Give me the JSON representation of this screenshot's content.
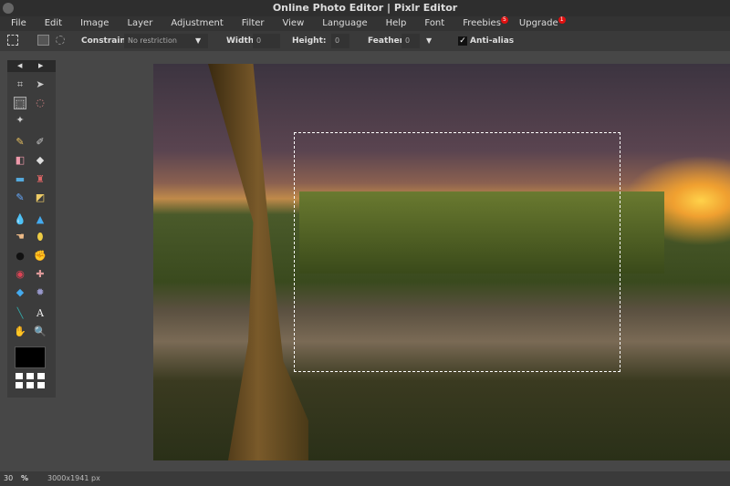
{
  "window": {
    "title": "Online Photo Editor | Pixlr Editor"
  },
  "menu": [
    {
      "label": "File"
    },
    {
      "label": "Edit"
    },
    {
      "label": "Image"
    },
    {
      "label": "Layer"
    },
    {
      "label": "Adjustment"
    },
    {
      "label": "Filter"
    },
    {
      "label": "View"
    },
    {
      "label": "Language"
    },
    {
      "label": "Help"
    },
    {
      "label": "Font"
    },
    {
      "label": "Freebies",
      "badge": "5"
    },
    {
      "label": "Upgrade",
      "badge": "1"
    }
  ],
  "options": {
    "constraint_label": "Constraint:",
    "constraint_value": "No restriction",
    "width_label": "Width:",
    "width_value": "0",
    "height_label": "Height:",
    "height_value": "0",
    "feather_label": "Feather:",
    "feather_value": "0",
    "antialias_label": "Anti-alias",
    "antialias_checked": true
  },
  "tools": [
    "crop-icon",
    "move-icon",
    "marquee-icon",
    "lasso-icon",
    "wand-icon",
    "pencil-icon",
    "brush-icon",
    "eraser-icon",
    "bucket-icon",
    "gradient-icon",
    "stamp-icon",
    "color-replace-icon",
    "drawing-icon",
    "blur-icon",
    "sharpen-icon",
    "smudge-icon",
    "sponge-icon",
    "dodge-icon",
    "burn-icon",
    "redeye-icon",
    "spot-heal-icon",
    "bloat-icon",
    "pinch-icon",
    "eyedropper-icon",
    "text-icon",
    "hand-icon",
    "zoom-icon"
  ],
  "text_tool_glyph": "A",
  "colors": {
    "foreground": "#000000"
  },
  "status": {
    "zoom": "30",
    "zoom_unit": "%",
    "dimensions": "3000x1941 px"
  }
}
